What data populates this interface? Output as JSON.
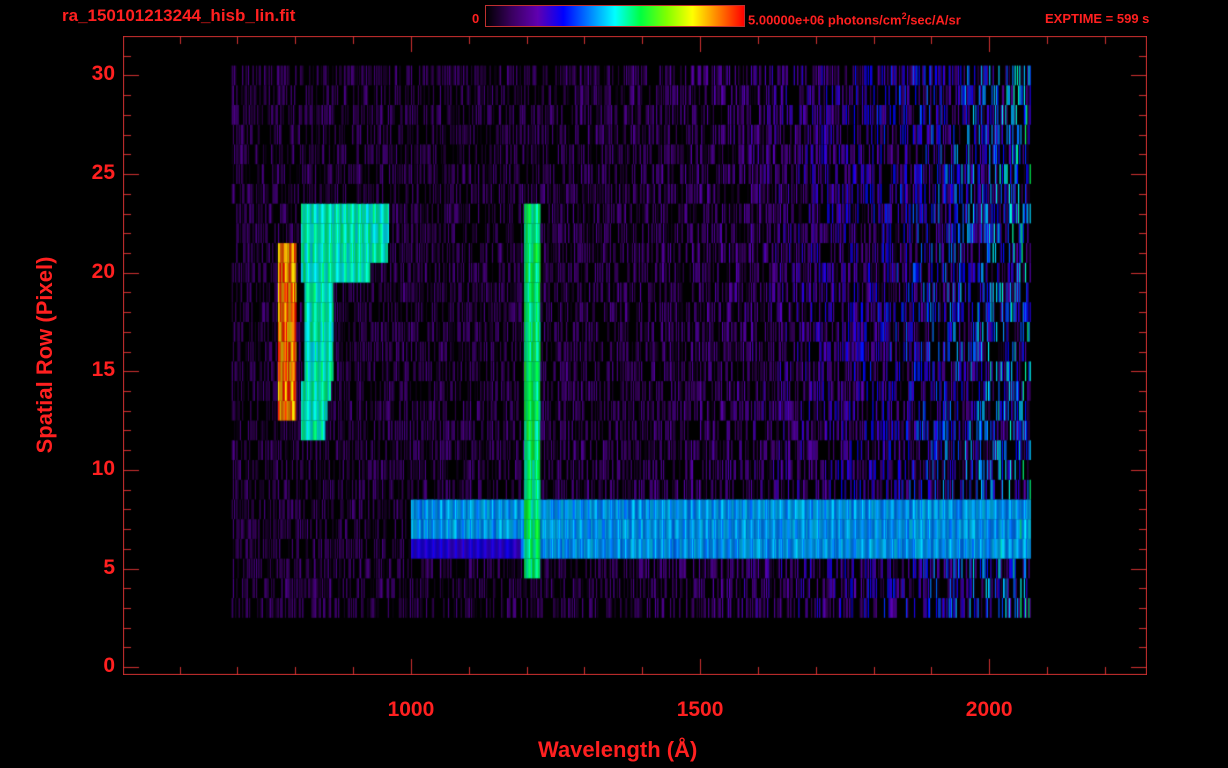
{
  "header": {
    "title": "ra_150101213244_hisb_lin.fit",
    "colorbar_min": "0",
    "colorbar_max": "5.00000e+06 photons/cm",
    "colorbar_unit_sup": "2",
    "colorbar_unit_rest": "/sec/A/sr",
    "exptime": "EXPTIME = 599 s"
  },
  "chart_data": {
    "type": "heatmap",
    "title": "ra_150101213244_hisb_lin.fit",
    "xlabel": "Wavelength (Å)",
    "ylabel": "Spatial Row (Pixel)",
    "xlim": [
      502,
      2273
    ],
    "ylim": [
      -0.4,
      32
    ],
    "xticks": [
      1000,
      1500,
      2000
    ],
    "xtick_labels": [
      "1000",
      "1500",
      "2000"
    ],
    "yticks": [
      0,
      5,
      10,
      15,
      20,
      25,
      30
    ],
    "ytick_labels": [
      "0",
      "5",
      "10",
      "15",
      "20",
      "25",
      "30"
    ],
    "colorbar": {
      "min": 0,
      "max": 5000000,
      "colormap": "rainbow"
    },
    "data_extent": {
      "wavelength": [
        690,
        2070
      ],
      "rows": [
        3,
        30
      ]
    },
    "features": [
      {
        "name": "Lyman-alpha line",
        "wavelength": [
          1195,
          1222
        ],
        "rows": [
          5,
          23
        ],
        "level": 0.6
      },
      {
        "name": "horizontal continuum band",
        "wavelength": [
          1000,
          2070
        ],
        "rows": [
          6,
          8
        ],
        "level": 0.45
      },
      {
        "name": "arc bright",
        "wavelength": [
          770,
          800
        ],
        "rows": [
          13,
          21
        ],
        "level": 0.95
      },
      {
        "name": "arc outer",
        "wavelength": [
          810,
          960
        ],
        "rows": [
          12,
          23
        ],
        "level": 0.55
      }
    ]
  }
}
